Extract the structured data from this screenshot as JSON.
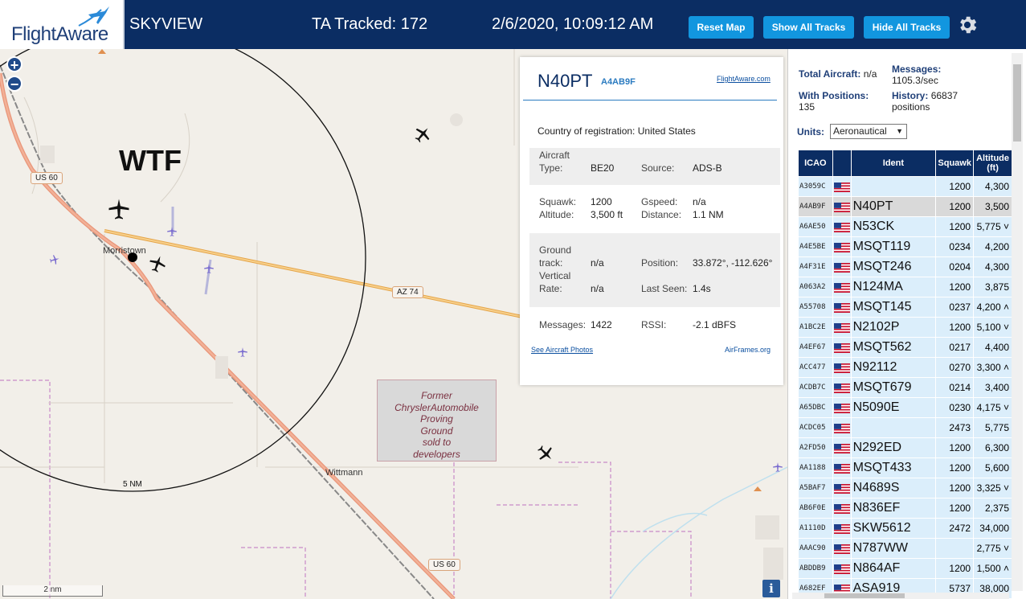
{
  "header": {
    "logo_text": "FlightAware",
    "app_title": "SKYVIEW",
    "tracked": "TA Tracked: 172",
    "datetime": "2/6/2020, 10:09:12 AM",
    "buttons": {
      "reset_map": "Reset Map",
      "show_all_tracks": "Show All Tracks",
      "hide_all_tracks": "Hide All Tracks"
    }
  },
  "map": {
    "zoom_in": "+",
    "zoom_out": "−",
    "annotation": "WTF",
    "towns": {
      "morristown": "Morristown",
      "wittmann": "Wittmann"
    },
    "roads": {
      "us60_top": "US 60",
      "us60_bottom": "US 60",
      "az74": "AZ 74"
    },
    "range_label": "5 NM",
    "area_label": "Former ChryslerAutomobile Proving Ground sold to developers",
    "area_lines": [
      "Former",
      "ChryslerAutomobile",
      "Proving",
      "Ground",
      "sold to",
      "developers"
    ],
    "scale_label": "2 nm",
    "info": "i"
  },
  "selected": {
    "ident": "N40PT",
    "hex": "A4AB9F",
    "flightaware_link": "FlightAware.com",
    "country_label": "Country of registration:",
    "country": "United States",
    "aircraft_label": "Aircraft",
    "type_label": "Type:",
    "type": "BE20",
    "source_label": "Source:",
    "source": "ADS-B",
    "squawk_label": "Squawk:",
    "squawk": "1200",
    "gspeed_label": "Gspeed:",
    "gspeed": "n/a",
    "altitude_label": "Altitude:",
    "altitude": "3,500 ft",
    "distance_label": "Distance:",
    "distance": "1.1 NM",
    "ground_label": "Ground",
    "track_label": "track:",
    "track": "n/a",
    "position_label": "Position:",
    "position": "33.872°, -112.626°",
    "vertical_label": "Vertical",
    "rate_label": "Rate:",
    "rate": "n/a",
    "last_seen_label": "Last Seen:",
    "last_seen": "1.4s",
    "messages_label": "Messages:",
    "messages": "1422",
    "rssi_label": "RSSI:",
    "rssi": "-2.1 dBFS",
    "photos_link": "See Aircraft Photos",
    "airframes_link": "AirFrames.org"
  },
  "panel": {
    "total_aircraft_label": "Total Aircraft:",
    "total_aircraft": "n/a",
    "messages_label": "Messages:",
    "messages": "1105.3/sec",
    "with_positions_label": "With Positions:",
    "with_positions": "135",
    "history_label": "History:",
    "history": "66837",
    "history_unit": "positions",
    "units_label": "Units:",
    "units_value": "Aeronautical",
    "columns": {
      "icao": "ICAO",
      "ident": "Ident",
      "squawk": "Squawk",
      "altitude": "Altitude",
      "altitude_unit": "(ft)"
    },
    "rows": [
      {
        "icao": "A3059C",
        "ident": "",
        "squawk": "1200",
        "altitude": "4,300"
      },
      {
        "icao": "A4AB9F",
        "ident": "N40PT",
        "squawk": "1200",
        "altitude": "3,500"
      },
      {
        "icao": "A6AE50",
        "ident": "N53CK",
        "squawk": "1200",
        "altitude": "5,775 ˅"
      },
      {
        "icao": "A4E5BE",
        "ident": "MSQT119",
        "squawk": "0234",
        "altitude": "4,200"
      },
      {
        "icao": "A4F31E",
        "ident": "MSQT246",
        "squawk": "0204",
        "altitude": "4,300"
      },
      {
        "icao": "A063A2",
        "ident": "N124MA",
        "squawk": "1200",
        "altitude": "3,875"
      },
      {
        "icao": "A55708",
        "ident": "MSQT145",
        "squawk": "0237",
        "altitude": "4,200 ˄"
      },
      {
        "icao": "A1BC2E",
        "ident": "N2102P",
        "squawk": "1200",
        "altitude": "5,100 ˅"
      },
      {
        "icao": "A4EF67",
        "ident": "MSQT562",
        "squawk": "0217",
        "altitude": "4,400"
      },
      {
        "icao": "ACC477",
        "ident": "N92112",
        "squawk": "0270",
        "altitude": "3,300 ˄"
      },
      {
        "icao": "ACDB7C",
        "ident": "MSQT679",
        "squawk": "0214",
        "altitude": "3,400"
      },
      {
        "icao": "A65DBC",
        "ident": "N5090E",
        "squawk": "0230",
        "altitude": "4,175 ˅"
      },
      {
        "icao": "ACDC05",
        "ident": "",
        "squawk": "2473",
        "altitude": "5,775"
      },
      {
        "icao": "A2FD50",
        "ident": "N292ED",
        "squawk": "1200",
        "altitude": "6,300"
      },
      {
        "icao": "AA1188",
        "ident": "MSQT433",
        "squawk": "1200",
        "altitude": "5,600"
      },
      {
        "icao": "A5BAF7",
        "ident": "N4689S",
        "squawk": "1200",
        "altitude": "3,325 ˅"
      },
      {
        "icao": "AB6F0E",
        "ident": "N836EF",
        "squawk": "1200",
        "altitude": "2,375"
      },
      {
        "icao": "A1110D",
        "ident": "SKW5612",
        "squawk": "2472",
        "altitude": "34,000"
      },
      {
        "icao": "AAAC90",
        "ident": "N787WW",
        "squawk": "",
        "altitude": "2,775 ˅"
      },
      {
        "icao": "ABDDB9",
        "ident": "N864AF",
        "squawk": "1200",
        "altitude": "1,500 ˄"
      },
      {
        "icao": "A682EF",
        "ident": "ASA919",
        "squawk": "5737",
        "altitude": "38,000"
      }
    ],
    "selected_row": 1
  }
}
